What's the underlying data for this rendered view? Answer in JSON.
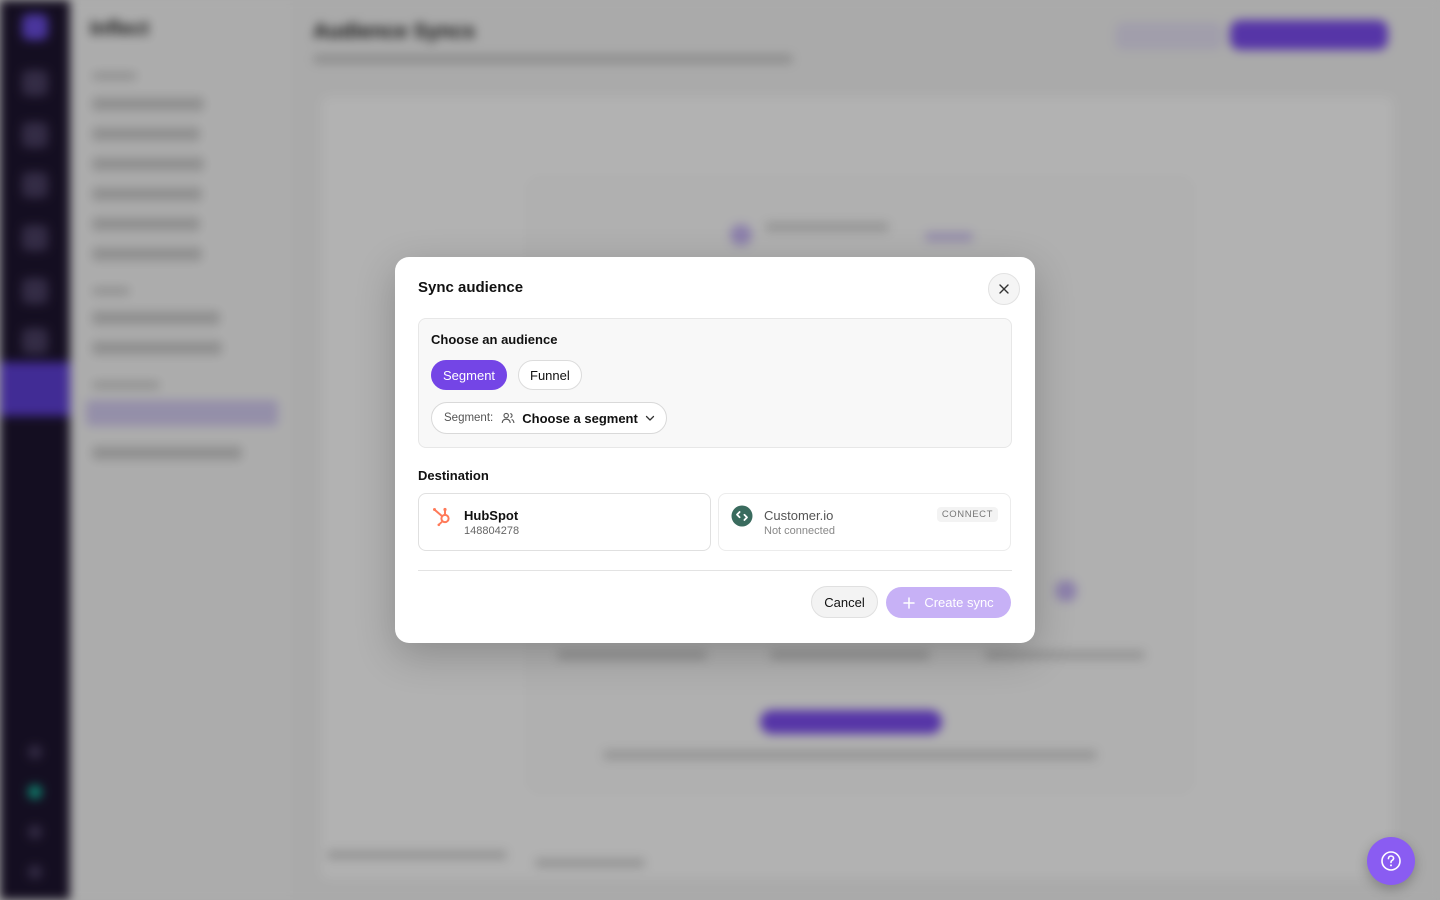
{
  "background": {
    "brand": "Inflect",
    "page_title": "Audience Syncs"
  },
  "modal": {
    "title": "Sync audience",
    "audience": {
      "label": "Choose an audience",
      "options": [
        "Segment",
        "Funnel"
      ],
      "selected": "Segment",
      "segment_prefix": "Segment:",
      "segment_value": "Choose a segment"
    },
    "destination": {
      "label": "Destination",
      "cards": [
        {
          "name": "HubSpot",
          "sub": "148804278",
          "icon": "hubspot-icon",
          "connected": true
        },
        {
          "name": "Customer.io",
          "sub": "Not connected",
          "icon": "customerio-icon",
          "connected": false,
          "badge": "CONNECT"
        }
      ]
    },
    "actions": {
      "cancel": "Cancel",
      "create": "Create sync"
    }
  },
  "colors": {
    "accent": "#7445e6",
    "accent_disabled": "#c7b1f6",
    "hubspot": "#ff7a59",
    "customerio": "#3a6b5e",
    "scrim": "rgba(0,0,0,0.30)"
  }
}
